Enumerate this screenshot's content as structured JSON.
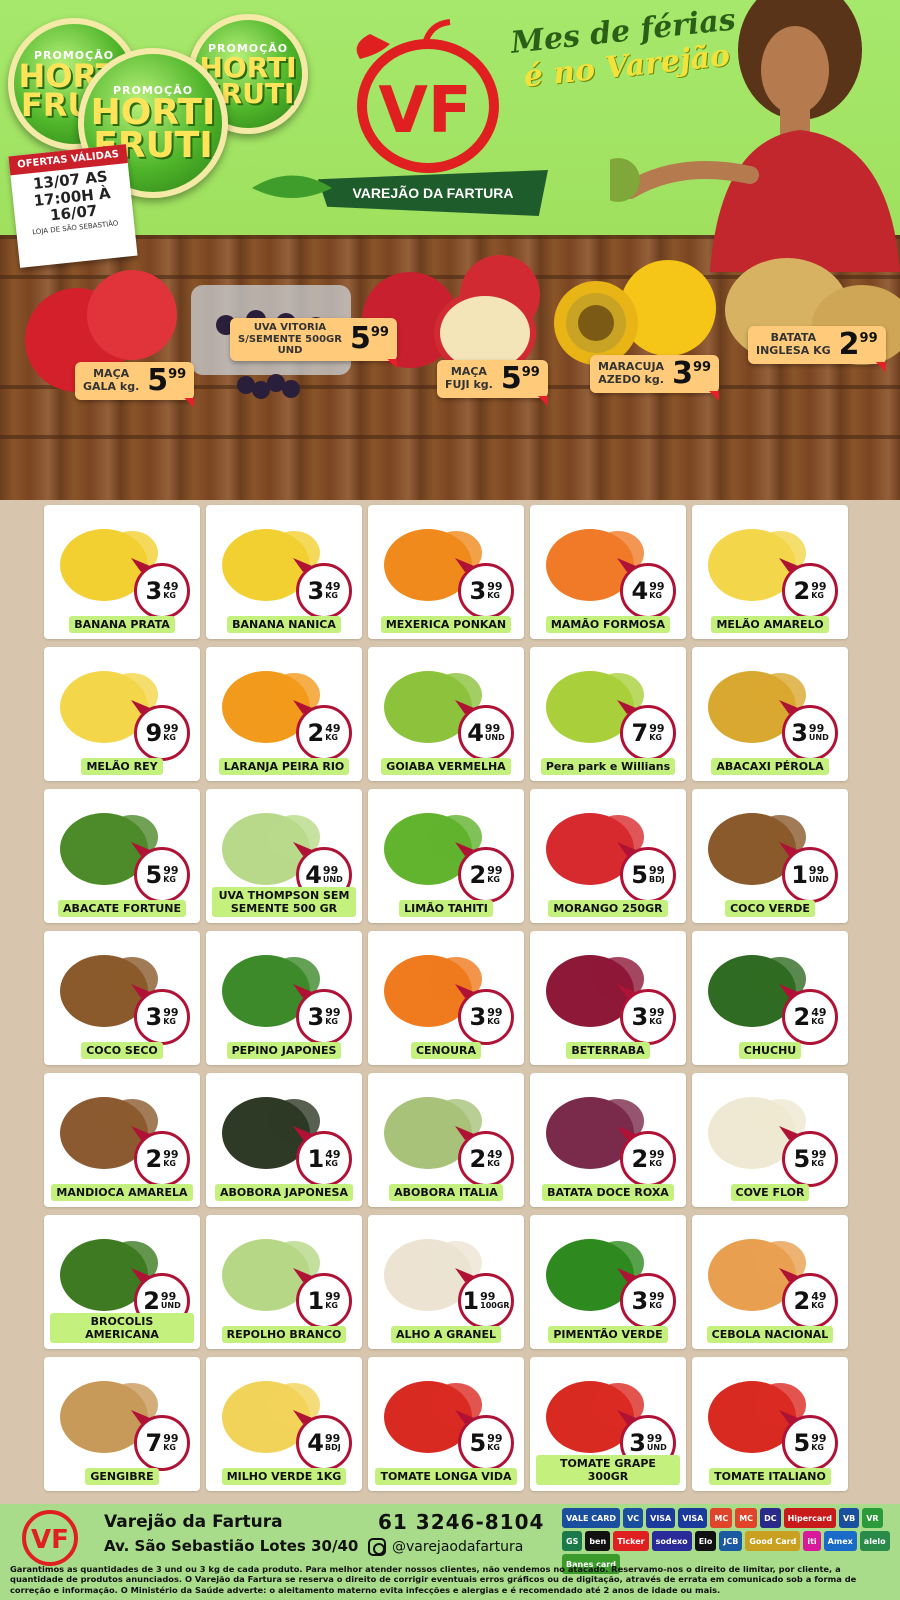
{
  "header": {
    "promo_badges": [
      {
        "top": "PROMOÇÃO",
        "big1": "HORTI",
        "big2": "FRUTI"
      },
      {
        "top": "PROMOÇÃO",
        "big1": "HORTI",
        "big2": "FRUTI"
      },
      {
        "top": "PROMOÇÃO",
        "big1": "HORTI",
        "big2": "FRUTI"
      }
    ],
    "validity": {
      "heading": "OFERTAS VÁLIDAS",
      "dates": "13/07 AS 17:00H À 16/07",
      "store": "LOJA DE SÃO SEBASTIÃO"
    },
    "brand": "VAREJÃO DA FARTURA",
    "logo_letters": "VF",
    "slogan_line1": "Mes de férias",
    "slogan_line2": "é no Varejão",
    "featured": [
      {
        "name": "MAÇA\nGALA kg.",
        "int": "5",
        "dec": "99"
      },
      {
        "name": "UVA VITORIA\nS/SEMENTE 500GR\nUND",
        "int": "5",
        "dec": "99"
      },
      {
        "name": "MAÇA\nFUJI kg.",
        "int": "5",
        "dec": "99"
      },
      {
        "name": "MARACUJA\nAZEDO kg.",
        "int": "3",
        "dec": "99"
      },
      {
        "name": "BATATA\nINGLESA KG",
        "int": "2",
        "dec": "99"
      }
    ]
  },
  "products": [
    {
      "name": "BANANA PRATA",
      "int": "3",
      "dec": "49",
      "unit": "KG",
      "icon": "banana-icon"
    },
    {
      "name": "BANANA NANICA",
      "int": "3",
      "dec": "49",
      "unit": "KG",
      "icon": "banana-icon"
    },
    {
      "name": "MEXERICA PONKAN",
      "int": "3",
      "dec": "99",
      "unit": "KG",
      "icon": "tangerine-icon"
    },
    {
      "name": "MAMÃO FORMOSA",
      "int": "4",
      "dec": "99",
      "unit": "KG",
      "icon": "papaya-icon"
    },
    {
      "name": "MELÃO AMARELO",
      "int": "2",
      "dec": "99",
      "unit": "KG",
      "icon": "melon-icon"
    },
    {
      "name": "MELÃO REY",
      "int": "9",
      "dec": "99",
      "unit": "KG",
      "icon": "melon-icon"
    },
    {
      "name": "LARANJA PEIRA RIO",
      "int": "2",
      "dec": "49",
      "unit": "KG",
      "icon": "orange-icon"
    },
    {
      "name": "GOIABA VERMELHA",
      "int": "4",
      "dec": "99",
      "unit": "UND",
      "icon": "guava-icon"
    },
    {
      "name": "Pera park e Willians",
      "int": "7",
      "dec": "99",
      "unit": "KG",
      "icon": "pear-icon"
    },
    {
      "name": "ABACAXI PÉROLA",
      "int": "3",
      "dec": "99",
      "unit": "UND",
      "icon": "pineapple-icon"
    },
    {
      "name": "ABACATE FORTUNE",
      "int": "5",
      "dec": "99",
      "unit": "KG",
      "icon": "avocado-icon"
    },
    {
      "name": "UVA THOMPSON SEM SEMENTE 500 GR",
      "int": "4",
      "dec": "99",
      "unit": "UND",
      "icon": "grape-icon"
    },
    {
      "name": "LIMÃO TAHITI",
      "int": "2",
      "dec": "99",
      "unit": "KG",
      "icon": "lime-icon"
    },
    {
      "name": "MORANGO 250GR",
      "int": "5",
      "dec": "99",
      "unit": "BDJ",
      "icon": "strawberry-icon"
    },
    {
      "name": "COCO VERDE",
      "int": "1",
      "dec": "99",
      "unit": "UND",
      "icon": "coconut-icon"
    },
    {
      "name": "COCO SECO",
      "int": "3",
      "dec": "99",
      "unit": "KG",
      "icon": "coconut-icon"
    },
    {
      "name": "PEPINO JAPONES",
      "int": "3",
      "dec": "99",
      "unit": "KG",
      "icon": "cucumber-icon"
    },
    {
      "name": "CENOURA",
      "int": "3",
      "dec": "99",
      "unit": "KG",
      "icon": "carrot-icon"
    },
    {
      "name": "BETERRABA",
      "int": "3",
      "dec": "99",
      "unit": "KG",
      "icon": "beet-icon"
    },
    {
      "name": "CHUCHU",
      "int": "2",
      "dec": "49",
      "unit": "KG",
      "icon": "chayote-icon"
    },
    {
      "name": "MANDIOCA AMARELA",
      "int": "2",
      "dec": "99",
      "unit": "KG",
      "icon": "cassava-icon"
    },
    {
      "name": "ABOBORA JAPONESA",
      "int": "1",
      "dec": "49",
      "unit": "KG",
      "icon": "pumpkin-icon"
    },
    {
      "name": "ABOBORA ITALIA",
      "int": "2",
      "dec": "49",
      "unit": "KG",
      "icon": "zucchini-icon"
    },
    {
      "name": "BATATA DOCE ROXA",
      "int": "2",
      "dec": "99",
      "unit": "KG",
      "icon": "sweet-potato-icon"
    },
    {
      "name": "COVE FLOR",
      "int": "5",
      "dec": "99",
      "unit": "KG",
      "icon": "cauliflower-icon"
    },
    {
      "name": "BROCOLIS AMERICANA",
      "int": "2",
      "dec": "99",
      "unit": "UND",
      "icon": "broccoli-icon"
    },
    {
      "name": "REPOLHO BRANCO",
      "int": "1",
      "dec": "99",
      "unit": "KG",
      "icon": "cabbage-icon"
    },
    {
      "name": "ALHO A GRANEL",
      "int": "1",
      "dec": "99",
      "unit": "100GR",
      "icon": "garlic-icon"
    },
    {
      "name": "PIMENTÃO VERDE",
      "int": "3",
      "dec": "99",
      "unit": "KG",
      "icon": "pepper-icon"
    },
    {
      "name": "CEBOLA NACIONAL",
      "int": "2",
      "dec": "49",
      "unit": "KG",
      "icon": "onion-icon"
    },
    {
      "name": "GENGIBRE",
      "int": "7",
      "dec": "99",
      "unit": "KG",
      "icon": "ginger-icon"
    },
    {
      "name": "MILHO VERDE 1KG",
      "int": "4",
      "dec": "99",
      "unit": "BDJ",
      "icon": "corn-icon"
    },
    {
      "name": "TOMATE LONGA VIDA",
      "int": "5",
      "dec": "99",
      "unit": "KG",
      "icon": "tomato-icon"
    },
    {
      "name": "TOMATE GRAPE 300GR",
      "int": "3",
      "dec": "99",
      "unit": "UND",
      "icon": "tomato-icon"
    },
    {
      "name": "TOMATE ITALIANO",
      "int": "5",
      "dec": "99",
      "unit": "KG",
      "icon": "tomato-icon"
    }
  ],
  "footer": {
    "name": "Varejão da Fartura",
    "address": "Av. São Sebastião Lotes 30/40",
    "phone": "61 3246-8104",
    "instagram": "@varejaodafartura",
    "payment_cards": [
      "VALE CARD",
      "VC",
      "VISA",
      "VISA",
      "MC",
      "MC",
      "DC",
      "Hipercard",
      "VB",
      "VR",
      "GS",
      "ben",
      "Ticker",
      "sodexo",
      "Elo",
      "JCB",
      "Good Card",
      "iti",
      "Amex",
      "alelo",
      "Banes card"
    ],
    "legal": "Garantimos as quantidades de 3 und ou 3 kg de cada produto. Para melhor atender nossos clientes, não vendemos no atacado. Reservamo-nos o direito de limitar, por cliente, a quantidade de produtos anunciados. O Varejão da Fartura se reserva o direito de corrigir eventuais erros gráficos ou de digitação, através de errata em comunicado sob a forma de correção e informação. O Ministério da Saúde adverte: o aleitamento materno evita infecções e alergias e é recomendado até 2 anos de idade ou mais."
  }
}
